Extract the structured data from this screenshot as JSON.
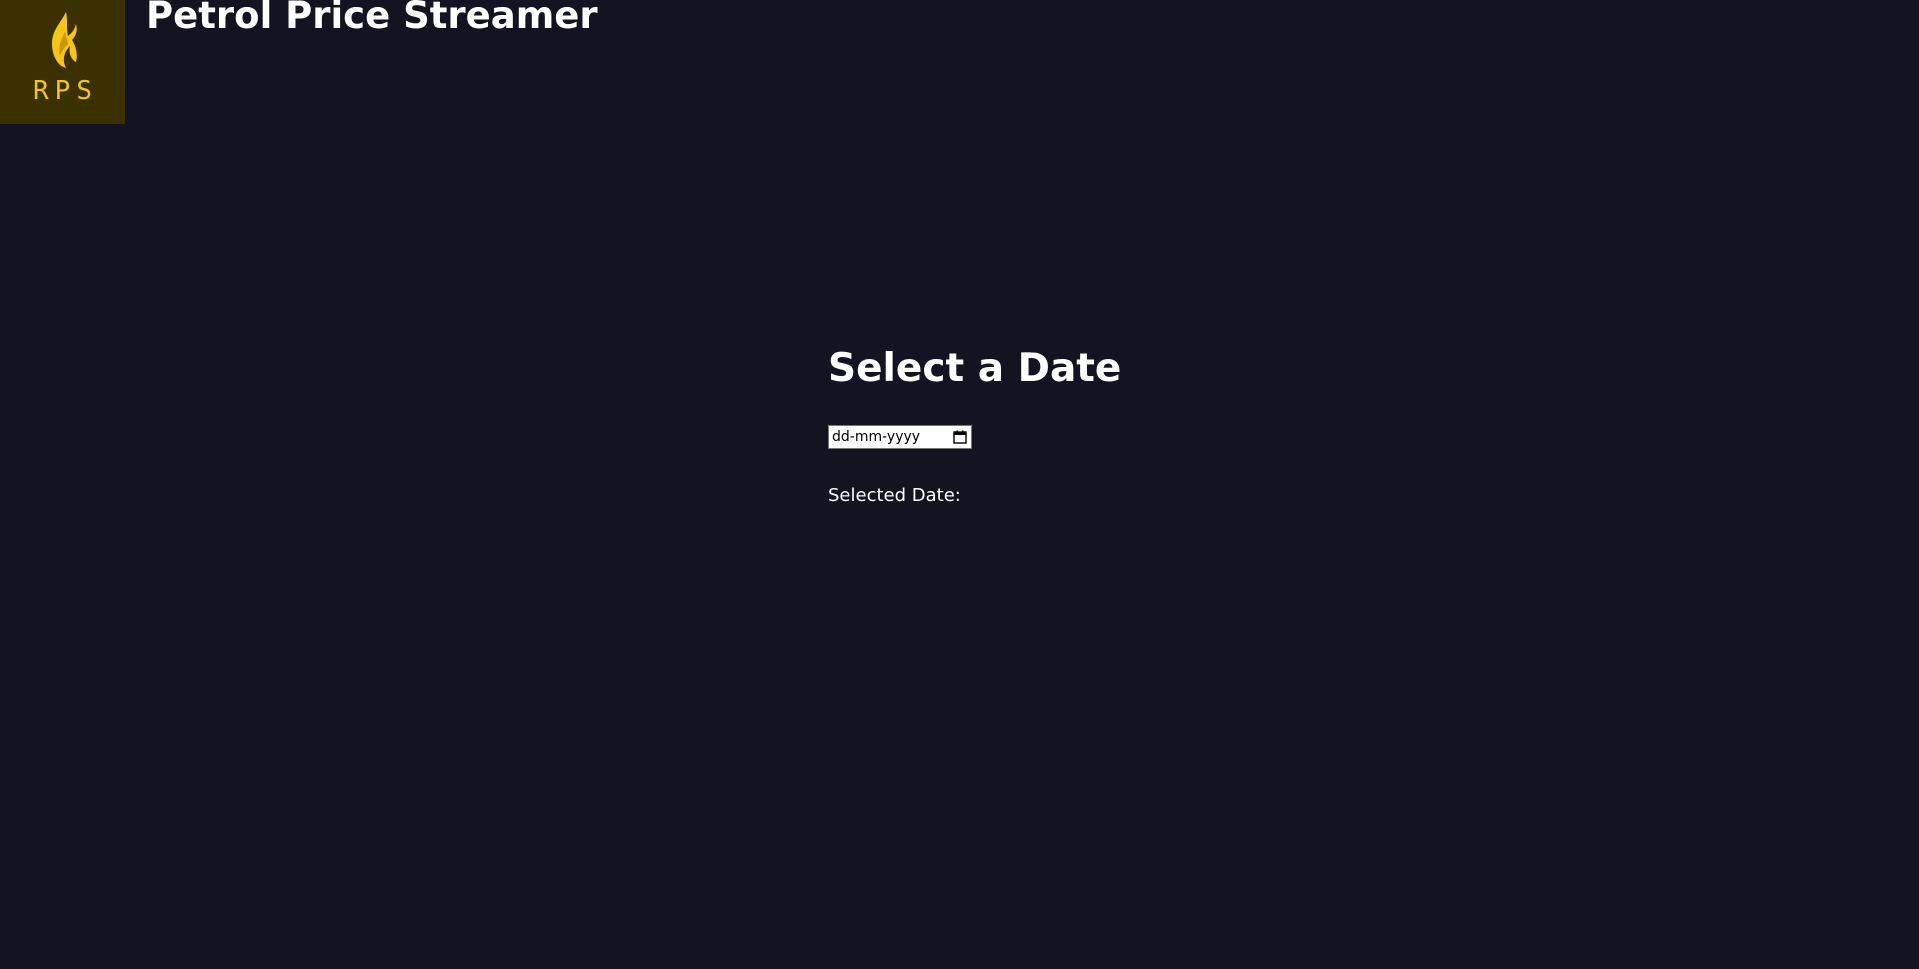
{
  "app": {
    "logo_text": "RPS",
    "logo_icon": "flame-icon",
    "title": "Petrol Price Streamer"
  },
  "panel": {
    "heading": "Select a Date",
    "date_input": {
      "placeholder": "dd-mm-yyyy",
      "value": "",
      "icon": "calendar-icon"
    },
    "selected_label": "Selected Date:",
    "selected_value": ""
  },
  "colors": {
    "background": "#131322",
    "logo_background": "#3a3000",
    "accent": "#f5c518",
    "text": "#ffffff"
  }
}
